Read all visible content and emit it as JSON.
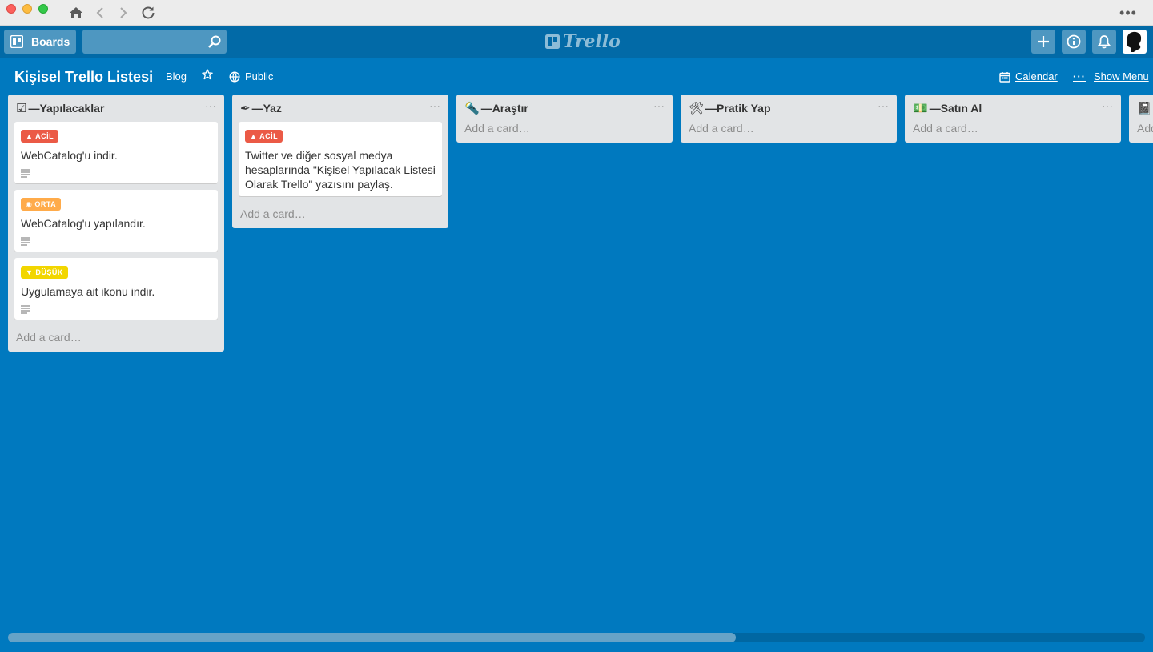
{
  "header": {
    "boards_label": "Boards",
    "search_placeholder": "",
    "logo_text": "Trello"
  },
  "board": {
    "title": "Kişisel Trello Listesi",
    "team": "Blog",
    "visibility": "Public",
    "calendar_label": "Calendar",
    "menu_label": "Show Menu"
  },
  "lists": [
    {
      "icon": "☑",
      "title": "—Yapılacaklar",
      "more": "···",
      "add_card": "Add a card…",
      "cards": [
        {
          "label": "▲ ACİL",
          "label_color": "#eb5a46",
          "text": "WebCatalog'u indir."
        },
        {
          "label": "◉ ORTA",
          "label_color": "#ffab4a",
          "text": "WebCatalog'u yapılandır."
        },
        {
          "label": "▼ DÜŞÜK",
          "label_color": "#f2d600",
          "text": "Uygulamaya ait ikonu indir."
        }
      ]
    },
    {
      "icon": "✒",
      "title": "—Yaz",
      "more": "···",
      "add_card": "Add a card…",
      "cards": [
        {
          "label": "▲ ACİL",
          "label_color": "#eb5a46",
          "text": "Twitter ve diğer sosyal medya hesaplarında \"Kişisel Yapılacak Listesi Olarak Trello\" yazısını paylaş."
        }
      ]
    },
    {
      "icon": "🔦",
      "title": "—Araştır",
      "more": "···",
      "add_card": "Add a card…"
    },
    {
      "icon": "🛠",
      "title": "—Pratik Yap",
      "more": "···",
      "add_card": "Add a card…"
    },
    {
      "icon": "💵",
      "title": "—Satın Al",
      "more": "···",
      "add_card": "Add a card…"
    },
    {
      "icon": "📓",
      "title": "",
      "more": "",
      "add_card": "Add"
    }
  ],
  "colors": {
    "board_bg": "#0079bf",
    "header_bg": "#026aa7",
    "list_bg": "#e2e4e6"
  }
}
